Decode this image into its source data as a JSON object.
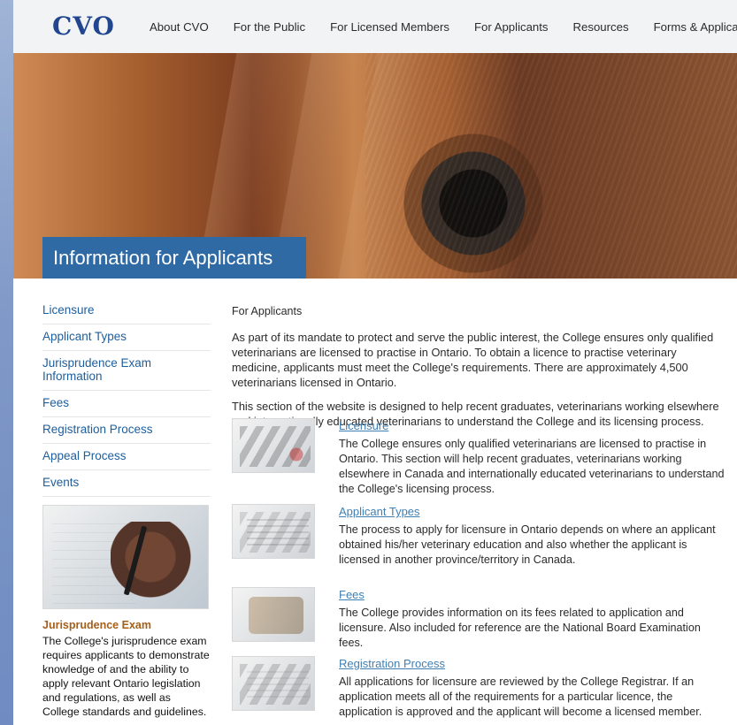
{
  "site": {
    "logo": "CVO",
    "nav": [
      "About CVO",
      "For the Public",
      "For Licensed Members",
      "For Applicants",
      "Resources",
      "Forms & Applications"
    ]
  },
  "hero": {
    "title": "Information for Applicants"
  },
  "sidebar": {
    "items": [
      "Licensure",
      "Applicant Types",
      "Jurisprudence Exam Information",
      "Fees",
      "Registration Process",
      "Appeal Process",
      "Events"
    ],
    "promo": {
      "title": "Jurisprudence Exam",
      "text": "The College's jurisprudence exam requires applicants to demonstrate knowledge of and the ability to apply relevant Ontario legislation and regulations, as well as College standards and guidelines."
    }
  },
  "main": {
    "crumb": "For Applicants",
    "intro_1": "As part of its mandate to protect and serve the public interest, the College ensures only qualified veterinarians are licensed to practise in Ontario. To obtain a licence to practise veterinary medicine, applicants must meet the College's requirements. There are approximately 4,500 veterinarians licensed in Ontario.",
    "intro_2": "This section of the website is designed to help recent graduates, veterinarians working elsewhere and internationally educated veterinarians to understand the College and its licensing process.",
    "items": [
      {
        "title": "Licensure",
        "text": "The College ensures only qualified veterinarians are licensed to practise in Ontario.  This section will help recent graduates, veterinarians working elsewhere in Canada and internationally educated veterinarians to understand the College's licensing process."
      },
      {
        "title": "Applicant Types",
        "text": "The process to apply for licensure in Ontario depends on where an applicant obtained his/her veterinary education and also whether the applicant is licensed in another province/territory in Canada."
      },
      {
        "title": "Fees",
        "text": "The College provides information on its fees related to application and licensure. Also included for reference are the National Board Examination fees."
      },
      {
        "title": "Registration Process",
        "text": "All applications for licensure are reviewed by the College Registrar. If an application meets all of the requirements for a particular licence, the application is approved and the applicant will become a licensed member."
      }
    ]
  }
}
